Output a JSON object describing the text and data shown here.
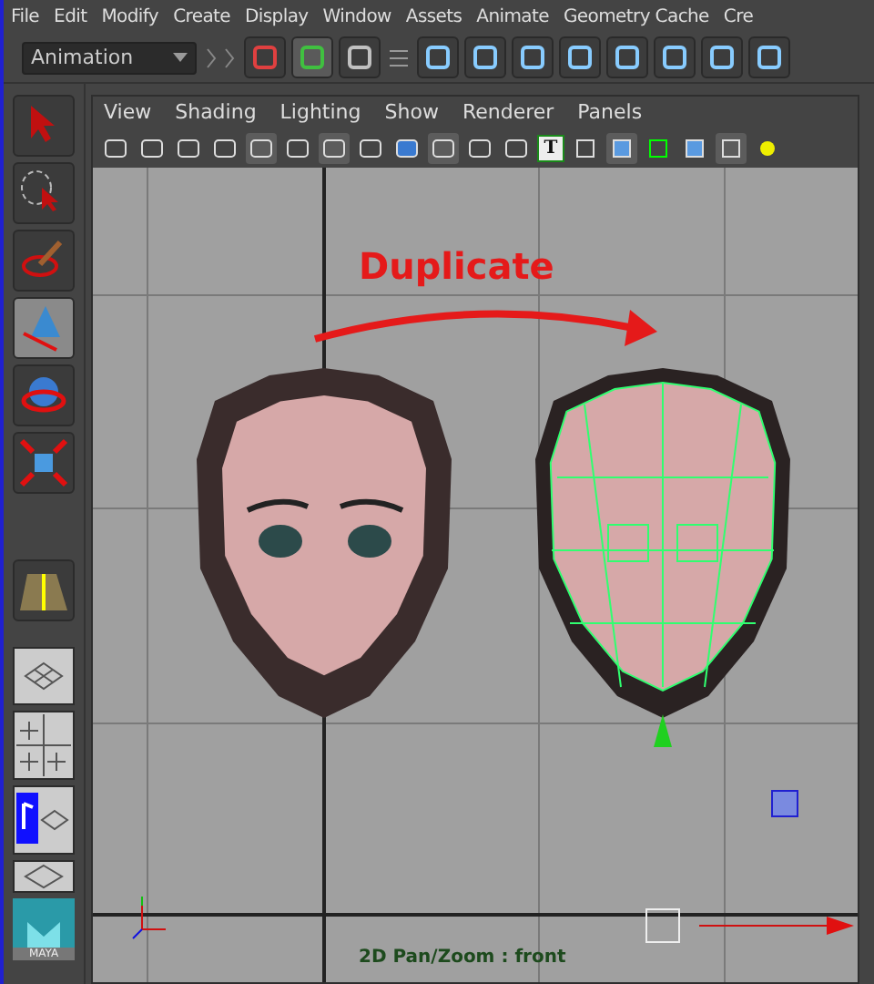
{
  "menu_bar": {
    "items": [
      "File",
      "Edit",
      "Modify",
      "Create",
      "Display",
      "Window",
      "Assets",
      "Animate",
      "Geometry Cache",
      "Cre"
    ]
  },
  "shelf": {
    "menu_set": "Animation"
  },
  "tool_box": {
    "tools": [
      {
        "selected": false
      },
      {
        "selected": false
      },
      {
        "selected": false
      },
      {
        "selected": true
      },
      {
        "selected": false
      },
      {
        "selected": false
      }
    ],
    "logo": "MAYA"
  },
  "panel": {
    "menu": [
      "View",
      "Shading",
      "Lighting",
      "Show",
      "Renderer",
      "Panels"
    ],
    "toolbar_text_icon": "T"
  },
  "viewport": {
    "annotation": "Duplicate",
    "hud": "2D Pan/Zoom : front"
  }
}
